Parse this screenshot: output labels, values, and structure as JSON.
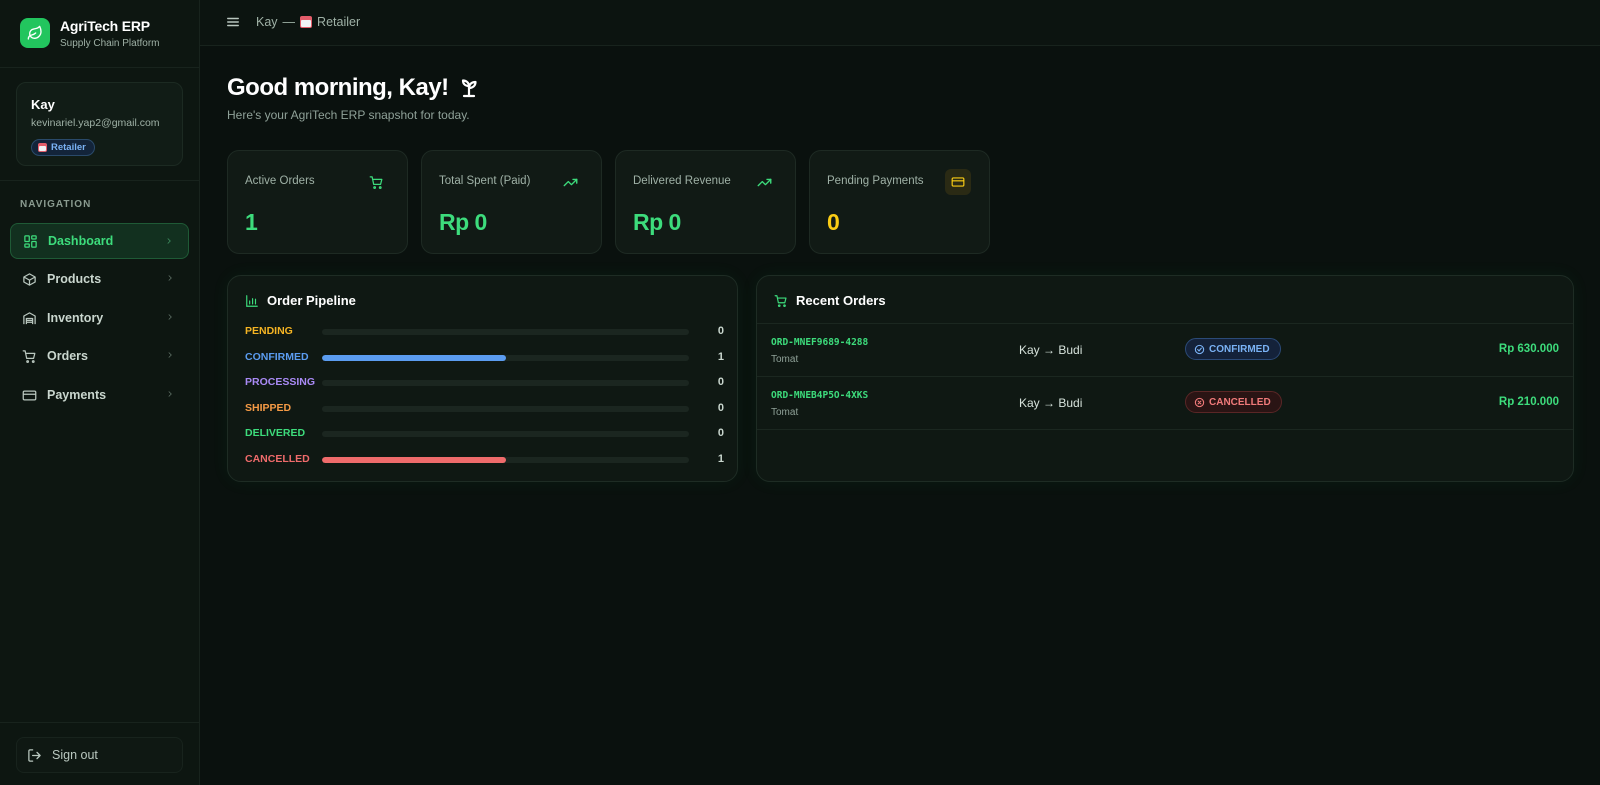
{
  "brand": {
    "name": "AgriTech ERP",
    "tagline": "Supply Chain Platform"
  },
  "user": {
    "name": "Kay",
    "email": "kevinariel.yap2@gmail.com",
    "role": "Retailer"
  },
  "nav": {
    "heading": "NAVIGATION",
    "items": [
      {
        "label": "Dashboard",
        "icon": "grid-icon",
        "active": true
      },
      {
        "label": "Products",
        "icon": "box-icon",
        "active": false
      },
      {
        "label": "Inventory",
        "icon": "warehouse-icon",
        "active": false
      },
      {
        "label": "Orders",
        "icon": "cart-icon",
        "active": false
      },
      {
        "label": "Payments",
        "icon": "card-icon",
        "active": false
      }
    ],
    "signout": "Sign out"
  },
  "topbar": {
    "user": "Kay",
    "separator": "—",
    "role": "Retailer"
  },
  "greeting": {
    "title": "Good morning, Kay!",
    "subtitle": "Here's your AgriTech ERP snapshot for today."
  },
  "stats": [
    {
      "label": "Active Orders",
      "value": "1",
      "icon": "cart-icon"
    },
    {
      "label": "Total Spent (Paid)",
      "value": "Rp 0",
      "icon": "trending-up-icon"
    },
    {
      "label": "Delivered Revenue",
      "value": "Rp 0",
      "icon": "trending-up-icon"
    },
    {
      "label": "Pending Payments",
      "value": "0",
      "icon": "card-icon"
    }
  ],
  "pipeline": {
    "title": "Order Pipeline",
    "rows": [
      {
        "label": "PENDING",
        "count": "0",
        "fraction": 0,
        "color": "#f5b423"
      },
      {
        "label": "CONFIRMED",
        "count": "1",
        "fraction": 0.5,
        "color": "#5b9cf0"
      },
      {
        "label": "PROCESSING",
        "count": "0",
        "fraction": 0,
        "color": "#a98af5"
      },
      {
        "label": "SHIPPED",
        "count": "0",
        "fraction": 0,
        "color": "#f59a45"
      },
      {
        "label": "DELIVERED",
        "count": "0",
        "fraction": 0,
        "color": "#3ddc7c"
      },
      {
        "label": "CANCELLED",
        "count": "1",
        "fraction": 0.5,
        "color": "#ef6b6b"
      }
    ]
  },
  "recent_orders": {
    "title": "Recent Orders",
    "rows": [
      {
        "id": "ORD-MNEF9689-4288",
        "product": "Tomat",
        "parties": "Kay → Budi",
        "status": "CONFIRMED",
        "amount": "Rp 630.000"
      },
      {
        "id": "ORD-MNEB4P5O-4XKS",
        "product": "Tomat",
        "parties": "Kay → Budi",
        "status": "CANCELLED",
        "amount": "Rp 210.000"
      }
    ]
  },
  "colors": {
    "accent": "#3ddc7c",
    "background": "#0a110e",
    "warning": "#facc15"
  }
}
